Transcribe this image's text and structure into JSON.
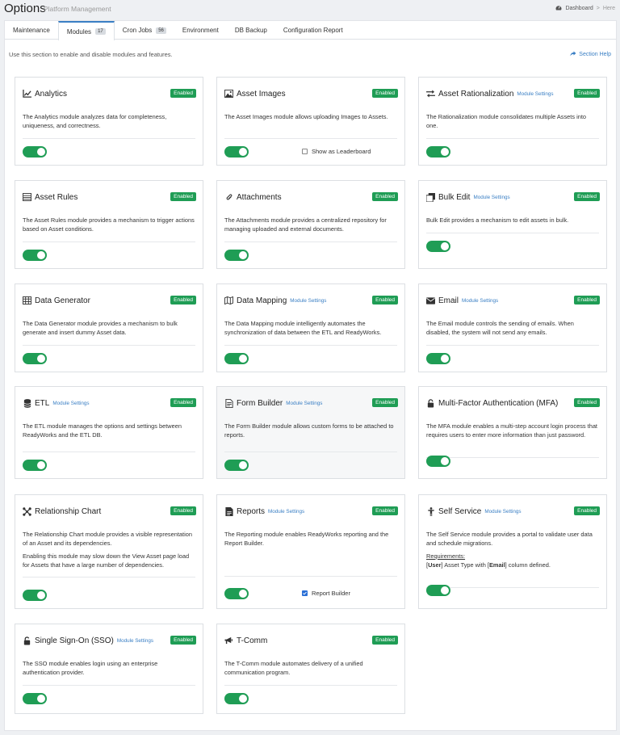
{
  "header": {
    "title": "Options",
    "subtitle": "Platform Management",
    "breadcrumb": {
      "dashboard": "Dashboard",
      "sep": ">",
      "here": "Here"
    }
  },
  "tabs": [
    {
      "label": "Maintenance"
    },
    {
      "label": "Modules",
      "count": "17"
    },
    {
      "label": "Cron Jobs",
      "count": "56"
    },
    {
      "label": "Environment"
    },
    {
      "label": "DB Backup"
    },
    {
      "label": "Configuration Report"
    }
  ],
  "description": "Use this section to enable and disable modules and features.",
  "section_help": "Section Help",
  "colors": {
    "accent": "#3a7fc4",
    "enabled": "#1f9d55"
  },
  "modules": [
    {
      "name": "Analytics",
      "status": "Enabled",
      "desc": "The Analytics module analyzes data for completeness, uniqueness, and correctness.",
      "icon": "line-chart-icon"
    },
    {
      "name": "Asset Images",
      "status": "Enabled",
      "desc": "The Asset Images module allows uploading Images to Assets.",
      "icon": "image-icon",
      "checkbox": "Show as Leaderboard"
    },
    {
      "name": "Asset Rationalization",
      "settings": "Module Settings",
      "status": "Enabled",
      "desc": "The Rationalization module consolidates multiple Assets into one.",
      "icon": "exchange-icon"
    },
    {
      "name": "Asset Rules",
      "status": "Enabled",
      "desc": "The Asset Rules module provides a mechanism to trigger actions based on Asset conditions.",
      "icon": "list-icon"
    },
    {
      "name": "Attachments",
      "status": "Enabled",
      "desc": "The Attachments module provides a centralized repository for managing uploaded and external documents.",
      "icon": "paperclip-icon"
    },
    {
      "name": "Bulk Edit",
      "settings": "Module Settings",
      "status": "Enabled",
      "desc": "Bulk Edit provides a mechanism to edit assets in bulk.",
      "icon": "bulk-edit-icon"
    },
    {
      "name": "Data Generator",
      "status": "Enabled",
      "desc": "The Data Generator module provides a mechanism to bulk generate and insert dummy Asset data.",
      "icon": "table-icon"
    },
    {
      "name": "Data Mapping",
      "settings": "Module Settings",
      "status": "Enabled",
      "desc": "The Data Mapping module intelligently automates the synchronization of data between the ETL and ReadyWorks.",
      "icon": "map-icon"
    },
    {
      "name": "Email",
      "settings": "Module Settings",
      "status": "Enabled",
      "desc": "The Email module controls the sending of emails. When disabled, the system will not send any emails.",
      "icon": "envelope-icon"
    },
    {
      "name": "ETL",
      "settings": "Module Settings",
      "status": "Enabled",
      "desc": "The ETL module manages the options and settings between ReadyWorks and the ETL DB.",
      "icon": "database-icon"
    },
    {
      "name": "Form Builder",
      "settings": "Module Settings",
      "status": "Enabled",
      "desc": "The Form Builder module allows custom forms to be attached to reports.",
      "icon": "form-icon"
    },
    {
      "name": "Multi-Factor Authentication (MFA)",
      "status": "Enabled",
      "desc": "The MFA module enables a multi-step account login process that requires users to enter more information than just password.",
      "icon": "lock-icon"
    },
    {
      "name": "Relationship Chart",
      "status": "Enabled",
      "desc": "The Relationship Chart module provides a visible representation of an Asset and its dependencies.",
      "desc2": "Enabling this module may slow down the View Asset page load for Assets that have a large number of dependencies.",
      "icon": "relationship-icon"
    },
    {
      "name": "Reports",
      "settings": "Module Settings",
      "status": "Enabled",
      "desc": "The Reporting module enables ReadyWorks reporting and the Report Builder.",
      "icon": "report-icon",
      "checkbox": "Report Builder"
    },
    {
      "name": "Self Service",
      "settings": "Module Settings",
      "status": "Enabled",
      "desc": "The Self Service module provides a portal to validate user data and schedule migrations.",
      "icon": "self-service-icon",
      "req_label": "Requirements:",
      "req_parts": [
        "[",
        "User",
        "] Asset Type with [",
        "Email",
        "] column defined."
      ]
    },
    {
      "name": "Single Sign-On (SSO)",
      "settings": "Module Settings",
      "status": "Enabled",
      "desc": "The SSO module enables login using an enterprise authentication provider.",
      "icon": "unlock-icon"
    },
    {
      "name": "T-Comm",
      "status": "Enabled",
      "desc": "The T-Comm module automates delivery of a unified communication program.",
      "icon": "bullhorn-icon"
    }
  ]
}
